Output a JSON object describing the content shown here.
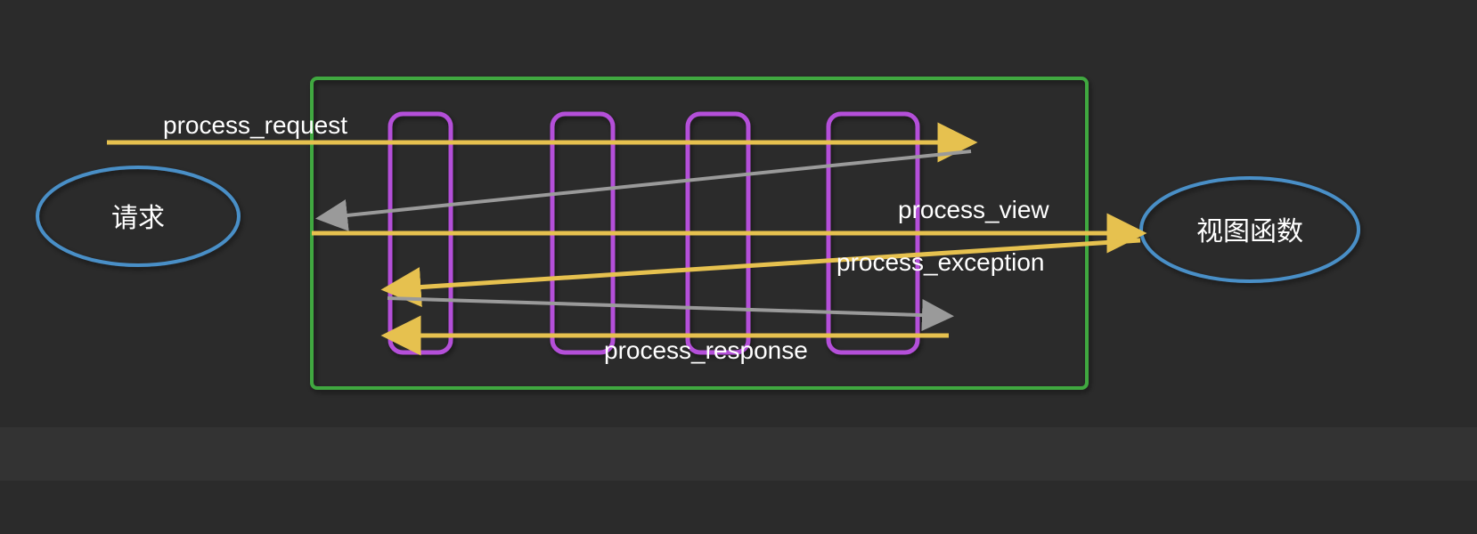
{
  "ellipses": {
    "left_label": "请求",
    "right_label": "视图函数"
  },
  "labels": {
    "process_request": "process_request",
    "process_view": "process_view",
    "process_exception": "process_exception",
    "process_response": "process_response"
  },
  "colors": {
    "background": "#2b2b2b",
    "container_border": "#3fa83f",
    "middleware_border": "#b44fd9",
    "ellipse_border": "#4a8fc7",
    "arrow_yellow": "#e6c14f",
    "arrow_gray": "#9a9a9a",
    "text": "#ffffff"
  },
  "diagram": {
    "middleware_count": 4
  }
}
